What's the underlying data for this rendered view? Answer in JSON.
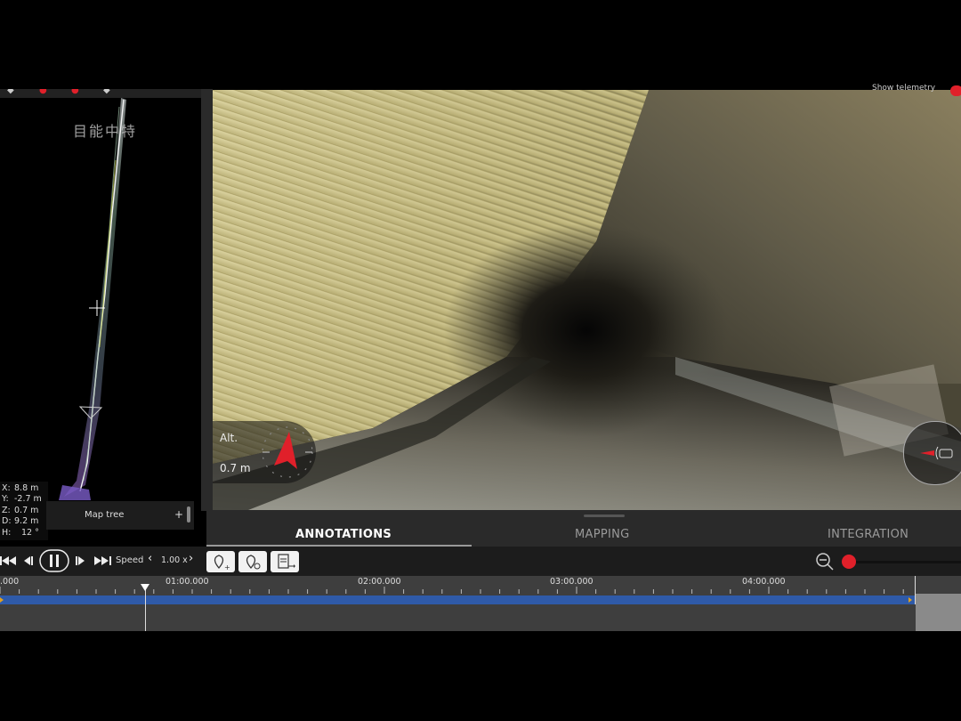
{
  "video": {
    "show_telemetry": "Show telemetry",
    "altitude_label": "Alt.",
    "altitude_value": "0.7 m"
  },
  "map": {
    "watermark": "目能中特",
    "coords": [
      {
        "k": "X:",
        "v": "8.8 m"
      },
      {
        "k": "Y:",
        "v": "-2.7 m"
      },
      {
        "k": "Z:",
        "v": "0.7 m"
      },
      {
        "k": "D:",
        "v": "9.2 m"
      },
      {
        "k": "H:",
        "v": "12 °"
      }
    ],
    "map_tree_label": "Map tree",
    "map_tree_add": "+"
  },
  "tabs": [
    {
      "label": "ANNOTATIONS",
      "active": true
    },
    {
      "label": "MAPPING",
      "active": false
    },
    {
      "label": "INTEGRATION",
      "active": false
    }
  ],
  "controls": {
    "speed_label": "Speed",
    "speed_value": "1.00 x"
  },
  "timeline": {
    "ticks": [
      ".000",
      "01:00.000",
      "02:00.000",
      "03:00.000",
      "04:00.000"
    ]
  },
  "colors": {
    "accent": "#e0202a",
    "track": "#2f5aa8"
  }
}
